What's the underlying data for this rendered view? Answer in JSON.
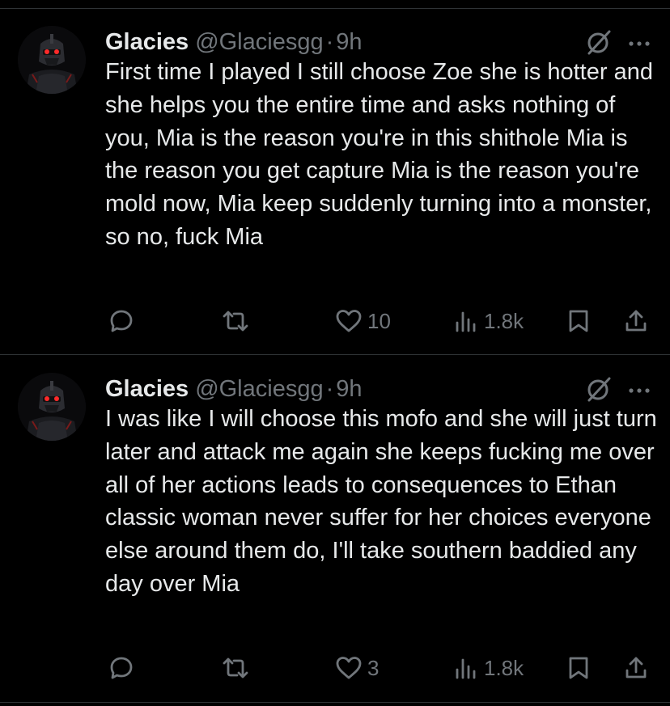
{
  "colors": {
    "background": "#000000",
    "text": "#e7e9ea",
    "muted": "#71767b",
    "divider": "#2f3336"
  },
  "tweets": [
    {
      "author": {
        "name": "Glacies",
        "handle": "@Glaciesgg",
        "separator": "·",
        "time": "9h"
      },
      "text": "First time I played I still choose Zoe she is hotter and she helps you the entire time and asks nothing of you, Mia is the reason you're in this shithole Mia is the reason you get capture Mia is the reason you're mold now, Mia keep suddenly turning into a monster, so no, fuck Mia",
      "icons": [
        "grok-icon",
        "more-icon",
        "reply-icon",
        "retweet-icon",
        "like-icon",
        "views-icon",
        "bookmark-icon",
        "share-icon"
      ],
      "stats": {
        "likes": "10",
        "views": "1.8k"
      }
    },
    {
      "author": {
        "name": "Glacies",
        "handle": "@Glaciesgg",
        "separator": "·",
        "time": "9h"
      },
      "text": "I was like I will choose this mofo and she will just turn later and attack me again she keeps fucking me over all of her actions leads to consequences to Ethan classic woman never suffer for her choices everyone else around them do, I'll take southern baddied any day over Mia",
      "icons": [
        "grok-icon",
        "more-icon",
        "reply-icon",
        "retweet-icon",
        "like-icon",
        "views-icon",
        "bookmark-icon",
        "share-icon"
      ],
      "stats": {
        "likes": "3",
        "views": "1.8k"
      }
    }
  ]
}
